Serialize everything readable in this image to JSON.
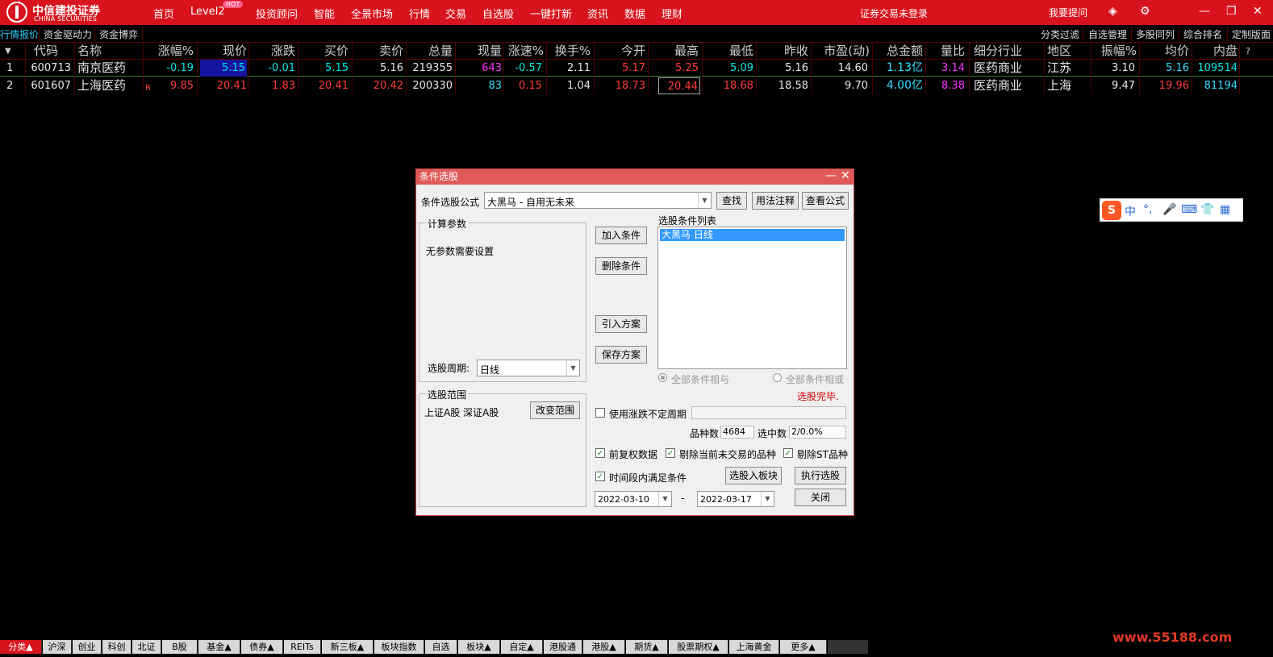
{
  "topbar": {
    "logo_cn": "中信建投证券",
    "logo_en": "CHINA SECURITIES",
    "nav": [
      "首页",
      "Level2",
      "投资顾问",
      "智能",
      "全景市场",
      "行情",
      "交易",
      "自选股",
      "一键打新",
      "资讯",
      "数据",
      "理财"
    ],
    "hot": "HOT",
    "trade_status": "证券交易未登录",
    "ask": "我要提问",
    "icons": [
      "cube-icon",
      "settings-icon",
      "minimize-icon",
      "restore-icon",
      "close-icon"
    ]
  },
  "tabs_left": [
    "行情报价",
    "资金驱动力",
    "资金博弈"
  ],
  "tabs_right": [
    "分类过滤",
    "自选管理",
    "多股同列",
    "综合排名",
    "定制版面"
  ],
  "table": {
    "headers": [
      "代码",
      "名称",
      "涨幅%",
      "现价",
      "涨跌",
      "买价",
      "卖价",
      "总量",
      "现量",
      "涨速%",
      "换手%",
      "今开",
      "最高",
      "最低",
      "昨收",
      "市盈(动)",
      "总金额",
      "量比",
      "细分行业",
      "地区",
      "振幅%",
      "均价",
      "内盘"
    ],
    "rows": [
      {
        "idx": "1",
        "code": "600713",
        "name": "南京医药",
        "flag": "",
        "chg_pct": "-0.19",
        "price": "5.15",
        "chg": "-0.01",
        "bid": "5.15",
        "ask": "5.16",
        "vol": "219355",
        "cur_vol": "643",
        "speed": "-0.57",
        "turnover": "2.11",
        "open": "5.17",
        "high": "5.25",
        "low": "5.09",
        "prev": "5.16",
        "pe": "14.60",
        "amount": "1.13亿",
        "vr": "3.14",
        "industry": "医药商业",
        "region": "江苏",
        "amp": "3.10",
        "avg": "5.16",
        "inner": "109514"
      },
      {
        "idx": "2",
        "code": "601607",
        "name": "上海医药",
        "flag": "R",
        "chg_pct": "9.85",
        "price": "20.41",
        "chg": "1.83",
        "bid": "20.41",
        "ask": "20.42",
        "vol": "200330",
        "cur_vol": "83",
        "speed": "0.15",
        "turnover": "1.04",
        "open": "18.73",
        "high": "20.44",
        "low": "18.68",
        "prev": "18.58",
        "pe": "9.70",
        "amount": "4.00亿",
        "vr": "8.38",
        "industry": "医药商业",
        "region": "上海",
        "amp": "9.47",
        "avg": "19.96",
        "inner": "81194"
      }
    ]
  },
  "dialog": {
    "title": "条件选股",
    "formula_label": "条件选股公式",
    "formula_value": "大黑马        - 自用无未来",
    "btn_find": "查找",
    "btn_usage": "用法注释",
    "btn_view": "查看公式",
    "params_group": "计算参数",
    "params_text": "无参数需要设置",
    "period_label": "选股周期:",
    "period_value": "日线",
    "range_group": "选股范围",
    "range_text": "上证A股  深证A股",
    "btn_change_range": "改变范围",
    "btn_add": "加入条件",
    "btn_delete": "删除条件",
    "btn_import": "引入方案",
    "btn_save": "保存方案",
    "list_label": "选股条件列表",
    "list_items": [
      "大黑马   日线"
    ],
    "radio_and": "全部条件相与",
    "radio_or": "全部条件相或",
    "status": "选股完毕.",
    "chk_unfixed": "使用涨跌不定周期",
    "count_label": "品种数",
    "count_value": "4684",
    "selected_label": "选中数",
    "selected_value": "2/0.0%",
    "chk_adjust": "前复权数据",
    "chk_exclude_untraded": "剔除当前未交易的品种",
    "chk_exclude_st": "剔除ST品种",
    "chk_period": "时间段内满足条件",
    "btn_to_block": "选股入板块",
    "btn_execute": "执行选股",
    "date_from": "2022-03-10",
    "date_sep": "-",
    "date_to": "2022-03-17",
    "btn_close": "关闭"
  },
  "ime": {
    "items": [
      "中",
      "°,",
      "mic-icon",
      "keyboard-icon",
      "shirt-icon",
      "grid-icon"
    ]
  },
  "bottom_tabs": [
    "分类▲",
    "沪深",
    "创业",
    "科创",
    "北证",
    "B股",
    "基金▲",
    "债券▲",
    "REITs",
    "新三板▲",
    "板块指数",
    "自选",
    "板块▲",
    "自定▲",
    "港股通",
    "港股▲",
    "期货▲",
    "股票期权▲",
    "上海黄金",
    "更多▲"
  ],
  "watermark": "www.55188.com"
}
